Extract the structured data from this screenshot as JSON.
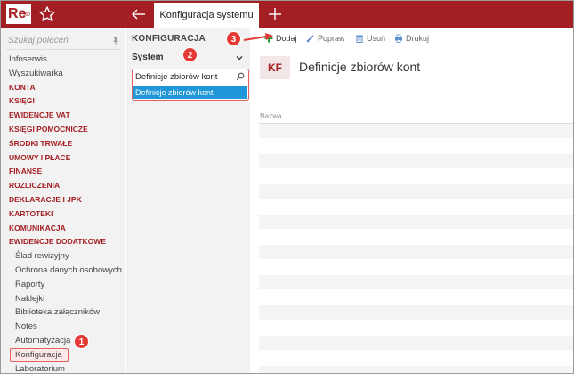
{
  "app": {
    "logo_text": "Re",
    "logo_sup": "360",
    "active_tab": "Konfiguracja systemu",
    "accent_color": "#a31f24"
  },
  "sidebar": {
    "search_placeholder": "Szukaj poleceń",
    "items": [
      {
        "label": "Infoserwis",
        "kind": "plain"
      },
      {
        "label": "Wyszukiwarka",
        "kind": "plain"
      },
      {
        "label": "KONTA",
        "kind": "section"
      },
      {
        "label": "KSIĘGI",
        "kind": "section"
      },
      {
        "label": "EWIDENCJE VAT",
        "kind": "section"
      },
      {
        "label": "KSIĘGI POMOCNICZE",
        "kind": "section"
      },
      {
        "label": "ŚRODKI TRWAŁE",
        "kind": "section"
      },
      {
        "label": "UMOWY I PŁACE",
        "kind": "section"
      },
      {
        "label": "FINANSE",
        "kind": "section"
      },
      {
        "label": "ROZLICZENIA",
        "kind": "section"
      },
      {
        "label": "DEKLARACJE I JPK",
        "kind": "section"
      },
      {
        "label": "KARTOTEKI",
        "kind": "section"
      },
      {
        "label": "KOMUNIKACJA",
        "kind": "section"
      },
      {
        "label": "EWIDENCJE DODATKOWE",
        "kind": "section"
      },
      {
        "label": "Ślad rewizyjny",
        "kind": "sub"
      },
      {
        "label": "Ochrona danych osobowych",
        "kind": "sub"
      },
      {
        "label": "Raporty",
        "kind": "sub"
      },
      {
        "label": "Naklejki",
        "kind": "sub"
      },
      {
        "label": "Biblioteka załączników",
        "kind": "sub"
      },
      {
        "label": "Notes",
        "kind": "sub"
      },
      {
        "label": "Automatyzacja",
        "kind": "sub"
      },
      {
        "label": "Konfiguracja",
        "kind": "sub",
        "active": true
      },
      {
        "label": "Laboratorium",
        "kind": "sub"
      }
    ]
  },
  "middle": {
    "title": "KONFIGURACJA",
    "selected_group": "System",
    "search_value": "Definicje zbiorów kont",
    "result_item": "Definicje zbiorów kont"
  },
  "toolbar": {
    "add_label": "Dodaj",
    "edit_label": "Popraw",
    "delete_label": "Usuń",
    "print_label": "Drukuj"
  },
  "main": {
    "badge": "KF",
    "title": "Definicje zbiorów kont",
    "column_header": "Nazwa"
  },
  "callouts": [
    "1",
    "2",
    "3"
  ]
}
